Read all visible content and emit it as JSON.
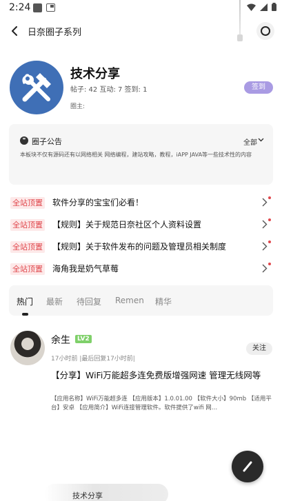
{
  "status_bar": {
    "time": "2:24"
  },
  "topbar": {
    "title": "日奈圈子系列"
  },
  "circle": {
    "name": "技术分享",
    "stats": "帖子: 42 互动: 7 签到: 1",
    "owner": "圈主:",
    "signin_label": "签到"
  },
  "notice": {
    "title": "圈子公告",
    "filter_label": "全部",
    "body": "本板块不仅有源码还有以网络相关 网络编程，建站攻略，教程，iAPP JAVA等一些技术性的内容"
  },
  "pinned": [
    {
      "badge": "全站顶置",
      "text": "软件分享的宝宝们必看！"
    },
    {
      "badge": "全站顶置",
      "text": "【规则】关于规范日奈社区个人资料设置"
    },
    {
      "badge": "全站顶置",
      "text": "【规则】关于软件发布的问题及管理员相关制度"
    },
    {
      "badge": "全站顶置",
      "text": "海角我是奶气草莓"
    }
  ],
  "tabs": [
    "热门",
    "最新",
    "待回复",
    "Remen",
    "精华"
  ],
  "post": {
    "author": "余生",
    "level": "LV2",
    "time": "17小时前 |最后回复17小时前|",
    "follow_label": "关注",
    "title": "【分享】WiFi万能超多连免费版增强网速 管理无线网等",
    "excerpt": "【应用名称】WiFi万能超多连 【应用版本】1.0.01.00 【软件大小】90mb 【适用平台】安卓 【应用简介】WiFi连接管理软件。软件提供了wifi 网…"
  },
  "bottom_tag": "技术分享",
  "colors": {
    "signin": "#a99be3",
    "pinned_badge_text": "#e0484d",
    "level_badge": "#7fd06a",
    "logo_bg": "#3f6fb6"
  }
}
